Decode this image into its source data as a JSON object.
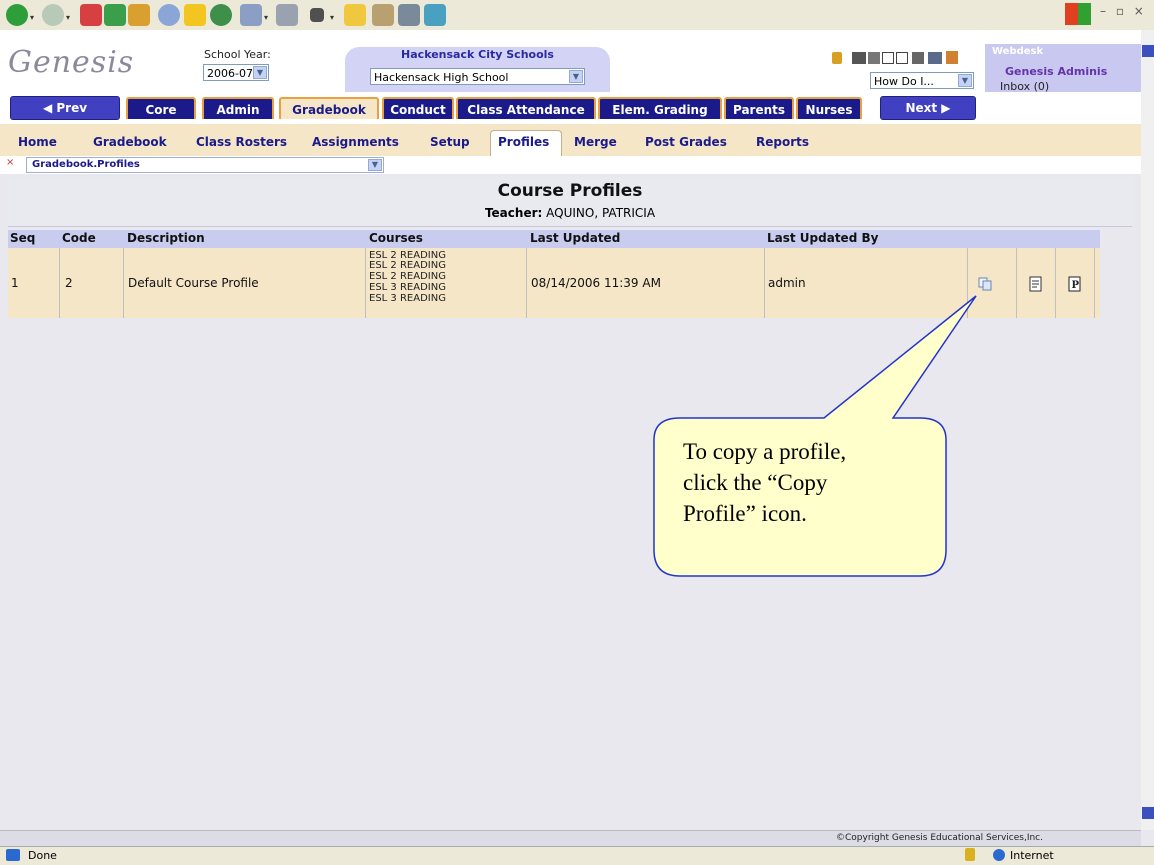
{
  "app": {
    "logo_text": "Genesis",
    "school_year_label": "School Year:",
    "school_year_value": "2006-07",
    "district_name": "Hackensack City Schools",
    "school_value": "Hackensack High School",
    "how_do_i": "How Do I...",
    "webdesk_label": "Webdesk",
    "user_name": "Genesis Adminis",
    "inbox": "Inbox (0)"
  },
  "tabs": {
    "prev": "◀ Prev",
    "items": [
      "Core",
      "Admin",
      "Gradebook",
      "Conduct",
      "Class Attendance",
      "Elem. Grading",
      "Parents",
      "Nurses"
    ],
    "active": "Gradebook",
    "next": "Next ▶"
  },
  "subnav": {
    "items": [
      "Home",
      "Gradebook",
      "Class Rosters",
      "Assignments",
      "Setup",
      "Profiles",
      "Merge",
      "Post Grades",
      "Reports"
    ],
    "active": "Profiles"
  },
  "crumb": "Gradebook.Profiles",
  "page": {
    "title": "Course Profiles",
    "teacher_label": "Teacher:",
    "teacher_name": "AQUINO, PATRICIA"
  },
  "table": {
    "columns": [
      "Seq",
      "Code",
      "Description",
      "Courses",
      "Last Updated",
      "Last Updated By"
    ],
    "rows": [
      {
        "seq": "1",
        "code": "2",
        "description": "Default Course Profile",
        "courses": [
          "ESL 2 READING",
          "ESL 2 READING",
          "ESL 2 READING",
          "ESL 3 READING",
          "ESL 3 READING"
        ],
        "last_updated": "08/14/2006 11:39 AM",
        "last_updated_by": "admin",
        "actions": [
          "copy-profile-icon",
          "edit-profile-icon",
          "print-profile-icon"
        ]
      }
    ]
  },
  "callout": {
    "lines": [
      "To copy a profile,",
      "click the “Copy",
      "Profile” icon."
    ]
  },
  "footer": {
    "copyright": "©Copyright Genesis Educational Services,Inc."
  },
  "statusbar": {
    "left": "Done",
    "zone": "Internet"
  },
  "colors": {
    "tab_bg": "#1a1a8a",
    "tab_border": "#e8a040",
    "subnav_bg": "#f5e6c7",
    "header_row_bg": "#c8cdf0",
    "callout_fill": "#ffffcc",
    "callout_stroke": "#2233cc"
  }
}
